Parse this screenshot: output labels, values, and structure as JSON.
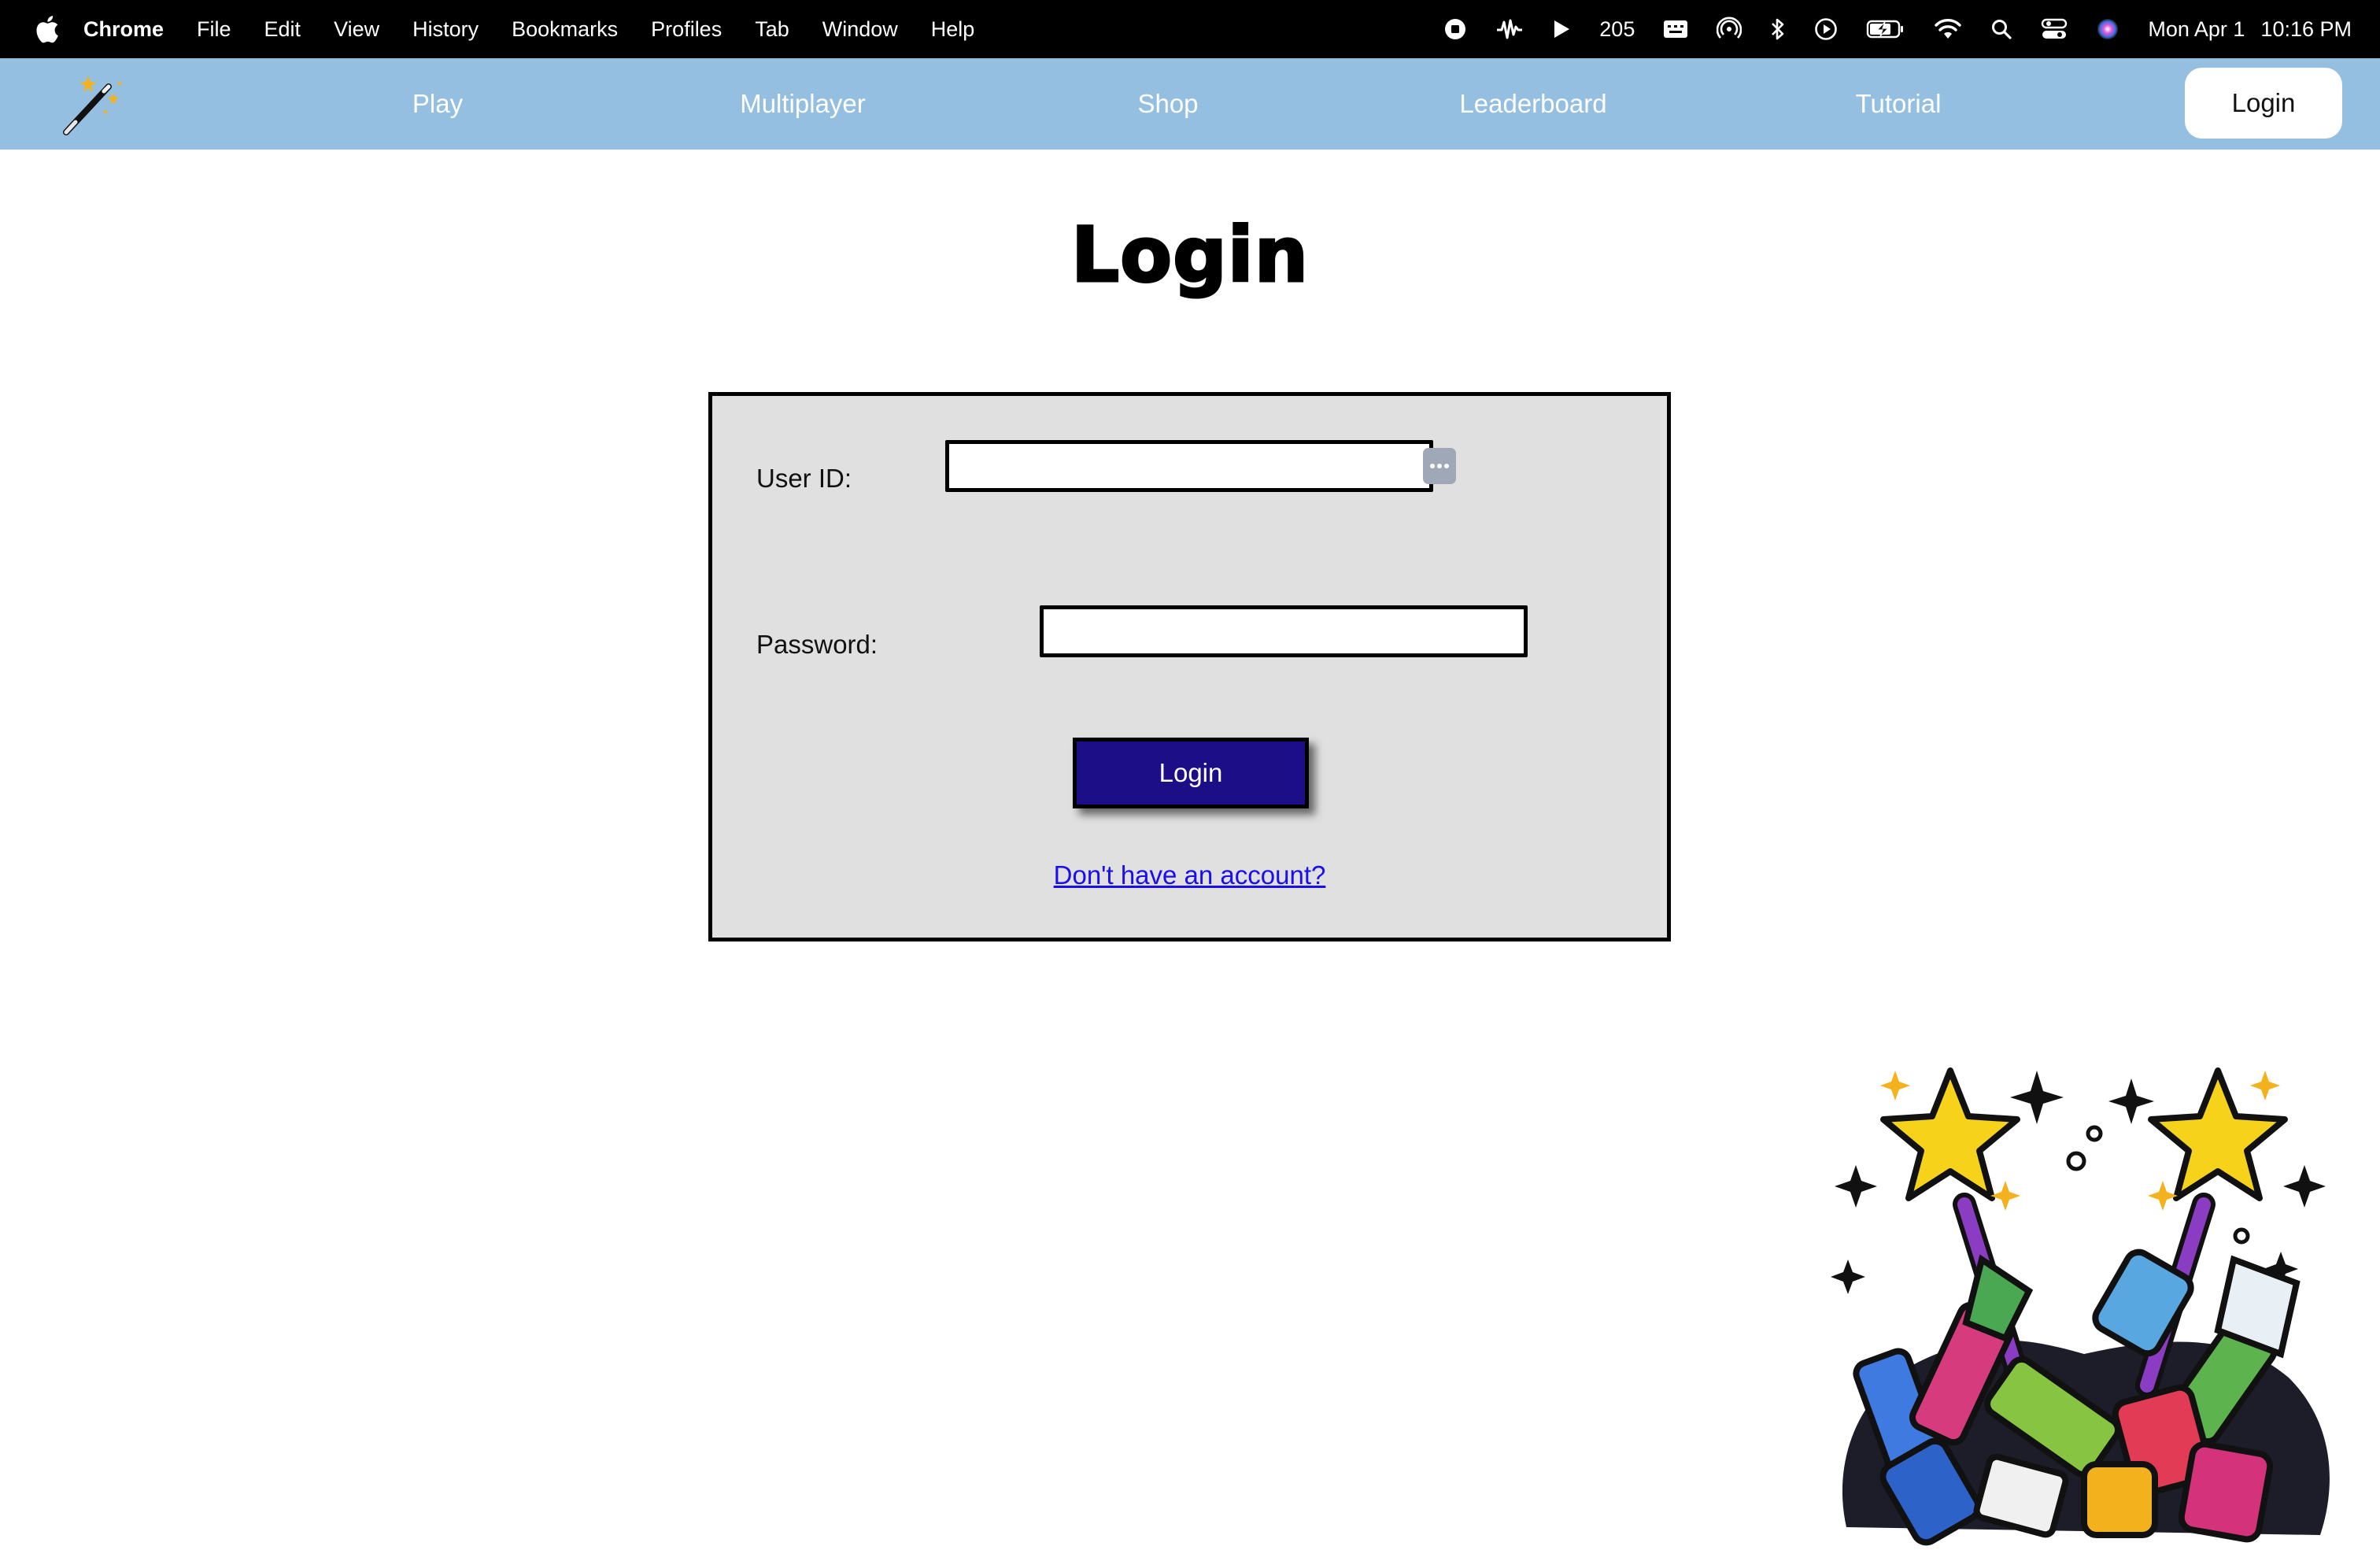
{
  "menubar": {
    "app_name": "Chrome",
    "menus": [
      "File",
      "Edit",
      "View",
      "History",
      "Bookmarks",
      "Profiles",
      "Tab",
      "Window",
      "Help"
    ],
    "status_number": "205",
    "date": "Mon Apr 1",
    "time": "10:16 PM"
  },
  "nav": {
    "items": [
      "Play",
      "Multiplayer",
      "Shop",
      "Leaderboard",
      "Tutorial"
    ],
    "login_label": "Login"
  },
  "page": {
    "title": "Login"
  },
  "form": {
    "user_id_label": "User ID:",
    "user_id_value": "",
    "password_label": "Password:",
    "password_value": "",
    "submit_label": "Login",
    "signup_link": "Don't have an account?"
  },
  "colors": {
    "nav_bg": "#94bfe0",
    "form_bg": "#e0e0e0",
    "button_bg": "#1c0e86",
    "link": "#1a0dee"
  }
}
